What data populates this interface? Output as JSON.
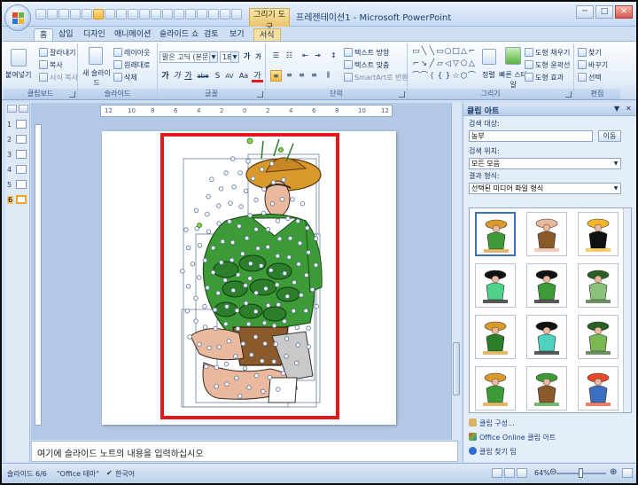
{
  "window": {
    "title": "프레젠테이션1 - Microsoft PowerPoint",
    "context_tab": "그리기 도구",
    "min": "─",
    "max": "□",
    "close": "✕"
  },
  "tabs": [
    "홈",
    "삽입",
    "디자인",
    "애니메이션",
    "슬라이드 쇼",
    "검토",
    "보기",
    "서식"
  ],
  "ribbon": {
    "clipboard": {
      "label": "클립보드",
      "paste": "붙여넣기",
      "cut": "잘라내기",
      "copy": "복사",
      "format_painter": "서식 복사"
    },
    "slides": {
      "label": "슬라이드",
      "new_slide": "새 슬라이드",
      "layout": "레이아웃",
      "reset": "원래대로",
      "delete": "삭제"
    },
    "font": {
      "label": "글꼴",
      "font_name": "맑은 고딕 (본문",
      "font_size": "18",
      "bold": "가",
      "italic": "가",
      "underline": "가",
      "strike": "abe",
      "shadow": "S",
      "spacing": "AV",
      "case": "Aa",
      "color": "가",
      "grow": "가",
      "shrink": "가",
      "clear": "가"
    },
    "paragraph": {
      "label": "단락",
      "text_direction": "텍스트 방향",
      "align_text": "텍스트 맞춤",
      "smartart": "SmartArt로 변환"
    },
    "drawing": {
      "label": "그리기",
      "arrange": "정렬",
      "quick_styles": "빠른 스타일",
      "shape_fill": "도형 채우기",
      "shape_outline": "도형 윤곽선",
      "shape_effects": "도형 효과"
    },
    "editing": {
      "label": "편집",
      "find": "찾기",
      "replace": "바꾸기",
      "select": "선택"
    }
  },
  "slides_pane": {
    "numbers": [
      "1",
      "2",
      "3",
      "4",
      "5",
      "6"
    ],
    "current_index": 5
  },
  "ruler": {
    "ticks": [
      "12",
      "10",
      "8",
      "6",
      "4",
      "2",
      "0",
      "2",
      "4",
      "6",
      "8",
      "10",
      "12"
    ]
  },
  "notes": {
    "placeholder": "여기에 슬라이드 노트의 내용을 입력하십시오"
  },
  "clip_art": {
    "title": "클립 아트",
    "search_label": "검색 대상:",
    "search_value": "농부",
    "go_button": "이동",
    "location_label": "검색 위치:",
    "location_value": "모든 모음",
    "type_label": "결과 형식:",
    "type_value": "선택된 미디어 파일 형식",
    "results": [
      "farmer-with-plant",
      "farmer-wheelbarrow",
      "farmer-silhouette",
      "farm-tool-green",
      "farmer-digging",
      "farmer-green-circle",
      "farmer-standing",
      "farm-tool-teal",
      "farmer-kneeling",
      "farmer-harvest",
      "farmer-pot",
      "farmer-fruit"
    ],
    "links": [
      "클립 구성...",
      "Office Online 클립 아트",
      "클립 찾기 팁"
    ]
  },
  "status": {
    "slide": "슬라이드 6/6",
    "theme": "\"Office 테마\"",
    "language": "한국어",
    "zoom": "64%",
    "zoom_fraction": 0.5
  },
  "colors": {
    "highlight": "#e1181c",
    "green": "#3c9b36",
    "hat": "#d99a2b",
    "skin": "#eab89c"
  }
}
